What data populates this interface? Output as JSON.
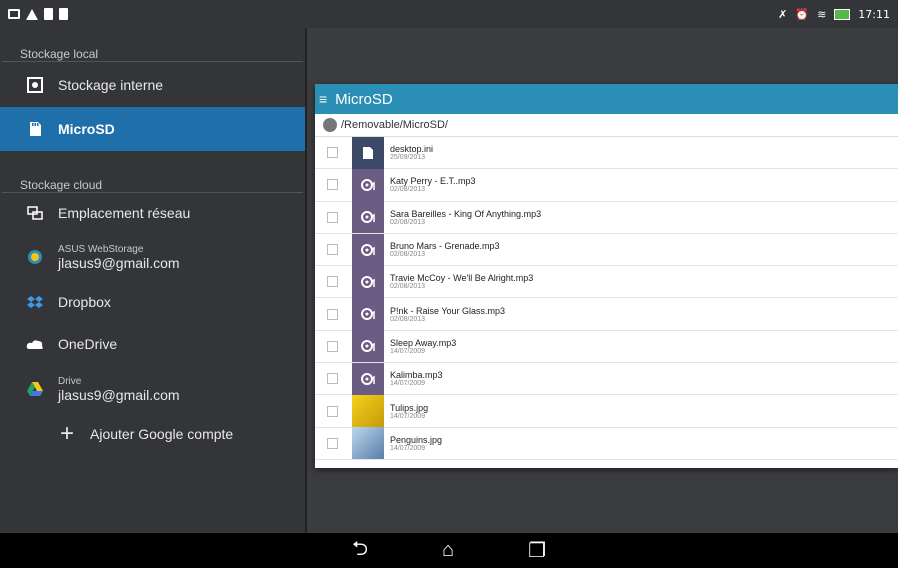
{
  "status": {
    "time": "17:11"
  },
  "drawer": {
    "local_header": "Stockage local",
    "cloud_header": "Stockage cloud",
    "items": {
      "internal": "Stockage interne",
      "microsd": "MicroSD",
      "network": "Emplacement réseau",
      "asus_sub": "ASUS WebStorage",
      "asus_main": "jlasus9@gmail.com",
      "dropbox": "Dropbox",
      "onedrive": "OneDrive",
      "drive_sub": "Drive",
      "drive_main": "jlasus9@gmail.com",
      "add_google": "Ajouter Google compte"
    }
  },
  "panel": {
    "title": "MicroSD",
    "path": "/Removable/MicroSD/",
    "files": [
      {
        "name": "desktop.ini",
        "date": "25/09/2013",
        "kind": "doc"
      },
      {
        "name": "Katy Perry - E.T..mp3",
        "date": "02/08/2013",
        "kind": "audio"
      },
      {
        "name": "Sara Bareilles - King Of Anything.mp3",
        "date": "02/08/2013",
        "kind": "audio"
      },
      {
        "name": "Bruno Mars - Grenade.mp3",
        "date": "02/08/2013",
        "kind": "audio"
      },
      {
        "name": "Travie McCoy - We'll Be Alright.mp3",
        "date": "02/08/2013",
        "kind": "audio"
      },
      {
        "name": "P!nk - Raise Your Glass.mp3",
        "date": "02/08/2013",
        "kind": "audio"
      },
      {
        "name": "Sleep Away.mp3",
        "date": "14/07/2009",
        "kind": "audio"
      },
      {
        "name": "Kalimba.mp3",
        "date": "14/07/2009",
        "kind": "audio"
      },
      {
        "name": "Tulips.jpg",
        "date": "14/07/2009",
        "kind": "img-tulips"
      },
      {
        "name": "Penguins.jpg",
        "date": "14/07/2009",
        "kind": "img-peng"
      }
    ]
  },
  "colors": {
    "accent": "#2b8fb5",
    "selected": "#1f6fab",
    "drawer": "#333538"
  }
}
